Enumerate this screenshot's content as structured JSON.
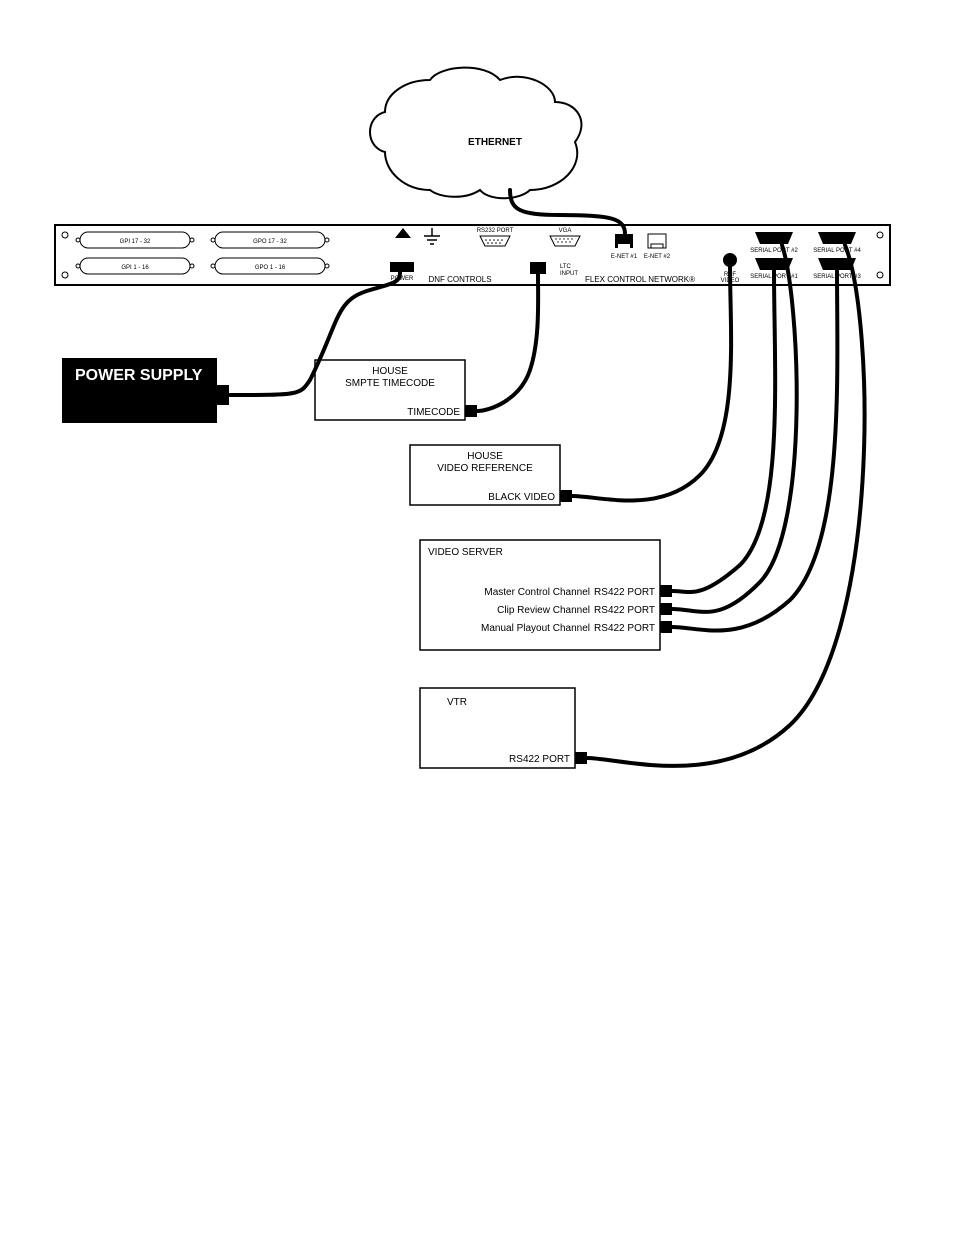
{
  "cloud": {
    "label": "ETHERNET"
  },
  "panel": {
    "gpi_top_left": "GPI 17 - 32",
    "gpi_bot_left": "GPI 1 - 16",
    "gpo_top_right": "GPO 17 - 32",
    "gpo_bot_right": "GPO 1 - 16",
    "rs232": "RS232 PORT",
    "vga": "VGA",
    "enet1": "E-NET #1",
    "enet2": "E-NET #2",
    "power": "POWER",
    "ltc": "LTC\nINPUT",
    "brand": "DNF CONTROLS",
    "network": "FLEX CONTROL NETWORK®",
    "ref_video": "REF\nVIDEO",
    "serial2": "SERIAL PORT #2",
    "serial4": "SERIAL PORT #4",
    "serial1": "SERIAL PORT #1",
    "serial3": "SERIAL PORT #3"
  },
  "power_supply": {
    "label": "POWER SUPPLY"
  },
  "box_timecode": {
    "title_1": "HOUSE",
    "title_2": "SMPTE TIMECODE",
    "port": "TIMECODE"
  },
  "box_videoref": {
    "title_1": "HOUSE",
    "title_2": "VIDEO REFERENCE",
    "port": "BLACK VIDEO"
  },
  "box_server": {
    "title": "VIDEO SERVER",
    "row1_name": "Master Control Channel",
    "row1_port": "RS422 PORT",
    "row2_name": "Clip Review Channel",
    "row2_port": "RS422 PORT",
    "row3_name": "Manual Playout Channel",
    "row3_port": "RS422 PORT"
  },
  "box_vtr": {
    "title": "VTR",
    "port": "RS422 PORT"
  }
}
